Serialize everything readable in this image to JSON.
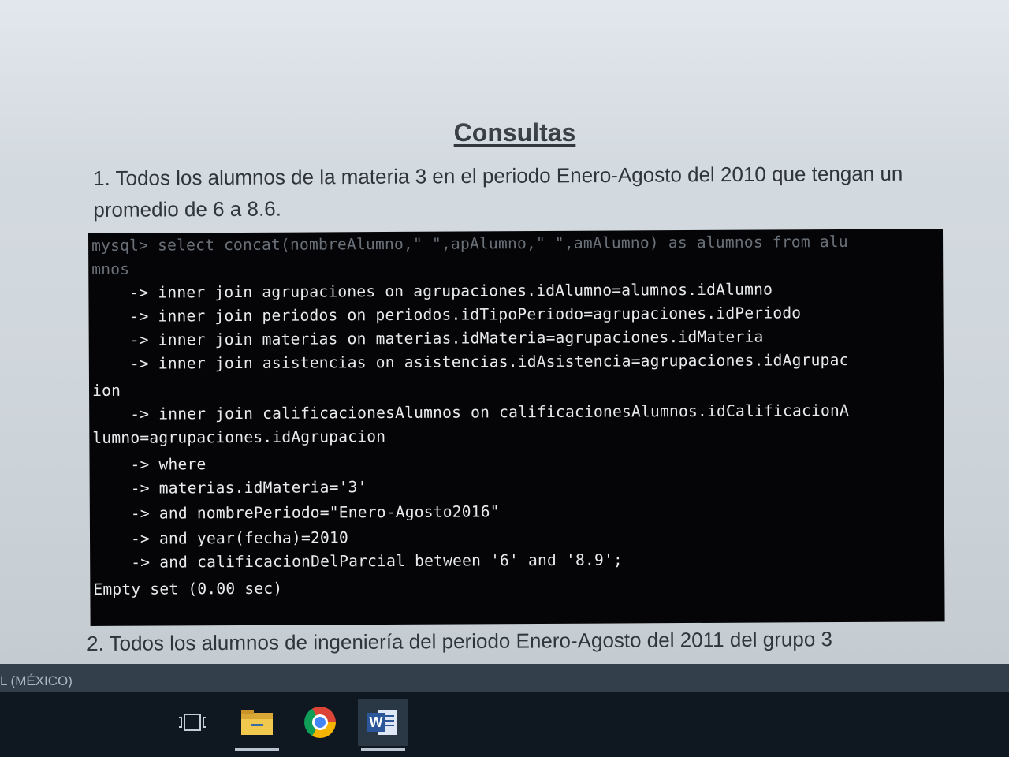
{
  "document": {
    "title": "Consultas",
    "question1": "1. Todos los alumnos de la materia 3 en el periodo Enero-Agosto del 2010 que tengan un promedio de 6 a 8.6.",
    "question2": "2. Todos los alumnos de ingeniería del periodo Enero-Agosto del 2011 del grupo 3"
  },
  "terminal": {
    "lines": [
      "mysql> select concat(nombreAlumno,\" \",apAlumno,\" \",amAlumno) as alumnos from alu",
      "mnos",
      "    -> inner join agrupaciones on agrupaciones.idAlumno=alumnos.idAlumno",
      "    -> inner join periodos on periodos.idTipoPeriodo=agrupaciones.idPeriodo",
      "    -> inner join materias on materias.idMateria=agrupaciones.idMateria",
      "    -> inner join asistencias on asistencias.idAsistencia=agrupaciones.idAgrupac",
      "ion",
      "    -> inner join calificacionesAlumnos on calificacionesAlumnos.idCalificacionA",
      "lumno=agrupaciones.idAgrupacion",
      "    -> where",
      "    -> materias.idMateria='3'",
      "    -> and nombrePeriodo=\"Enero-Agosto2016\"",
      "    -> and year(fecha)=2010",
      "    -> and calificacionDelParcial between '6' and '8.9';",
      "Empty set (0.00 sec)"
    ]
  },
  "statusbar": {
    "language": "L (MÉXICO)"
  },
  "taskbar": {
    "items": [
      {
        "name": "task-view",
        "icon": "task-view-icon"
      },
      {
        "name": "file-explorer",
        "icon": "folder-icon"
      },
      {
        "name": "chrome",
        "icon": "chrome-icon"
      },
      {
        "name": "word",
        "icon": "word-icon",
        "badge": "W"
      }
    ]
  }
}
